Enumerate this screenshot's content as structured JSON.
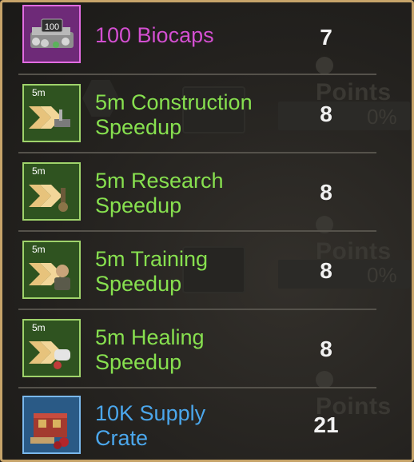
{
  "rewards": [
    {
      "icon": "biocaps-icon",
      "icon_text": "100",
      "name": "100 Biocaps",
      "quantity": "7",
      "color": "#d34fd1"
    },
    {
      "icon": "construction-speedup-icon",
      "icon_text": "5m",
      "name_line1": "5m Construction",
      "name_line2": "Speedup",
      "quantity": "8",
      "color": "#87e04f"
    },
    {
      "icon": "research-speedup-icon",
      "icon_text": "5m",
      "name_line1": "5m Research",
      "name_line2": "Speedup",
      "quantity": "8",
      "color": "#87e04f"
    },
    {
      "icon": "training-speedup-icon",
      "icon_text": "5m",
      "name_line1": "5m Training",
      "name_line2": "Speedup",
      "quantity": "8",
      "color": "#87e04f"
    },
    {
      "icon": "healing-speedup-icon",
      "icon_text": "5m",
      "name_line1": "5m Healing",
      "name_line2": "Speedup",
      "quantity": "8",
      "color": "#87e04f"
    },
    {
      "icon": "supply-crate-icon",
      "name_line1": "10K Supply",
      "name_line2": "Crate",
      "quantity": "21",
      "color": "#4ba7ec"
    }
  ]
}
